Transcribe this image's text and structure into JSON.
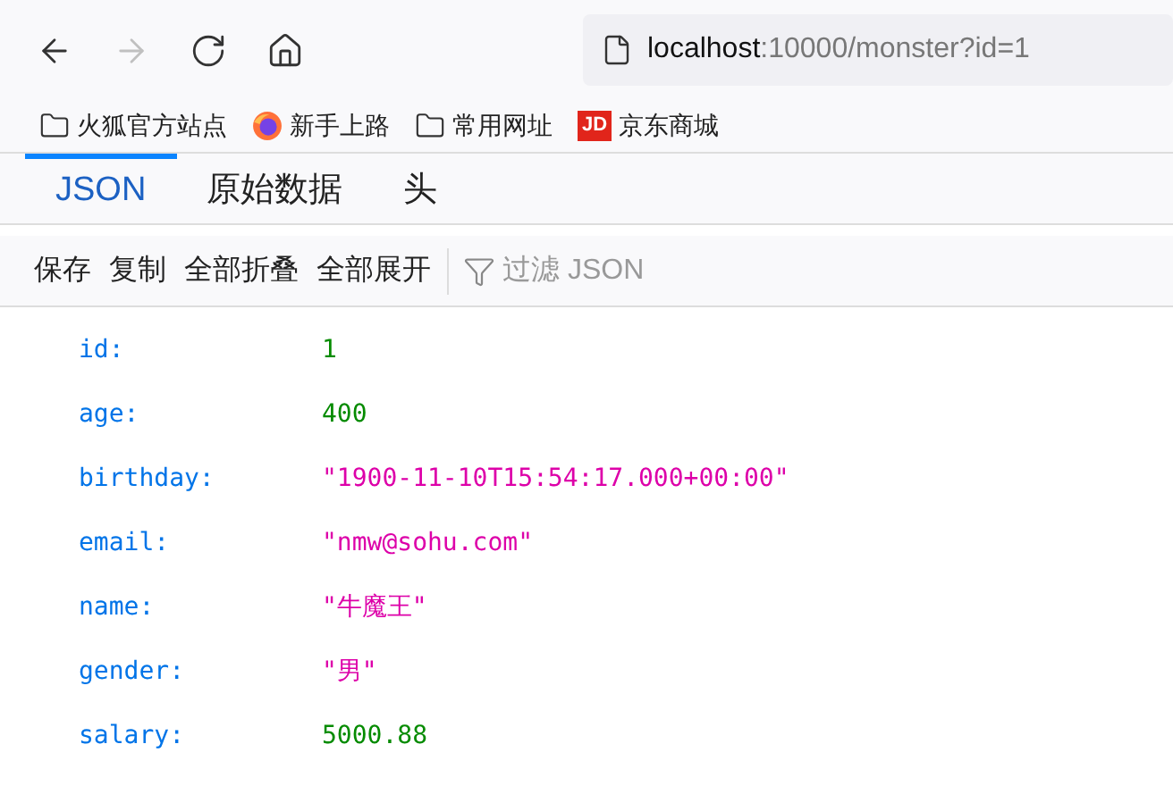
{
  "nav_buttons": [
    {
      "kind": "back",
      "disabled": false
    },
    {
      "kind": "forward",
      "disabled": true
    },
    {
      "kind": "reload",
      "disabled": false
    },
    {
      "kind": "home",
      "disabled": false
    }
  ],
  "address_bar": {
    "host": "localhost",
    "rest": ":10000/monster?id=1"
  },
  "bookmarks": [
    {
      "kind": "folder",
      "label": "火狐官方站点"
    },
    {
      "kind": "firefox",
      "label": "新手上路"
    },
    {
      "kind": "folder",
      "label": "常用网址"
    },
    {
      "kind": "jd",
      "label": "京东商城",
      "logo": "JD"
    }
  ],
  "tabs": [
    {
      "label": "JSON",
      "selected": true
    },
    {
      "label": "原始数据",
      "selected": false
    },
    {
      "label": "头",
      "selected": false
    }
  ],
  "toolbar": [
    "保存",
    "复制",
    "全部折叠",
    "全部展开"
  ],
  "filter": {
    "placeholder": "过滤 JSON"
  },
  "rows": [
    {
      "key": "id:",
      "value": "1",
      "kind": "number"
    },
    {
      "key": "age:",
      "value": "400",
      "kind": "number"
    },
    {
      "key": "birthday:",
      "value": "\"1900-11-10T15:54:17.000+00:00\"",
      "kind": "string"
    },
    {
      "key": "email:",
      "value": "\"nmw@sohu.com\"",
      "kind": "string"
    },
    {
      "key": "name:",
      "value": "\"牛魔王\"",
      "kind": "string"
    },
    {
      "key": "gender:",
      "value": "\"男\"",
      "kind": "string"
    },
    {
      "key": "salary:",
      "value": "5000.88",
      "kind": "number"
    }
  ]
}
